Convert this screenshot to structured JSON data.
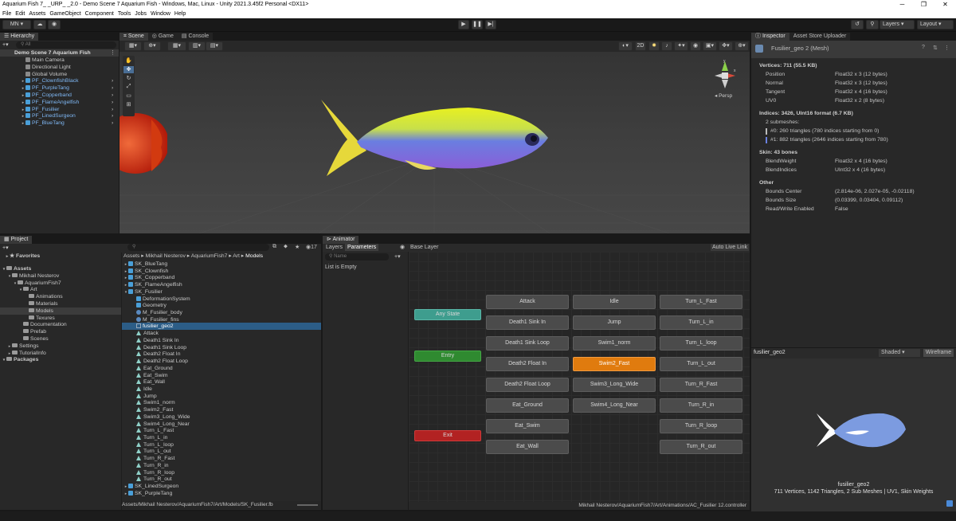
{
  "window": {
    "title": "Aquarium Fish 7_ _URP_ _2.0 - Demo Scene 7 Aquarium Fish - Windows, Mac, Linux - Unity 2021.3.45f2 Personal <DX11>",
    "minimize": "─",
    "maximize": "❐",
    "close": "✕"
  },
  "menu": [
    "File",
    "Edit",
    "Assets",
    "GameObject",
    "Component",
    "Tools",
    "Jobs",
    "Window",
    "Help"
  ],
  "toolbar": {
    "account": "MN ▾",
    "layers": "Layers",
    "layout": "Layout"
  },
  "hierarchy": {
    "tab": "Hierarchy",
    "search_placeholder": "All",
    "scene": "Demo Scene 7 Aquarium Fish",
    "items": [
      {
        "label": "Main Camera",
        "prefab": false
      },
      {
        "label": "Directional Light",
        "prefab": false
      },
      {
        "label": "Global Volume",
        "prefab": false
      },
      {
        "label": "PF_ClownfishBlack",
        "prefab": true
      },
      {
        "label": "PF_PurpleTang",
        "prefab": true
      },
      {
        "label": "PF_Copperband",
        "prefab": true
      },
      {
        "label": "PF_FlameAngelfish",
        "prefab": true
      },
      {
        "label": "PF_Fusilier",
        "prefab": true
      },
      {
        "label": "PF_LinedSurgeon",
        "prefab": true
      },
      {
        "label": "PF_BlueTang",
        "prefab": true
      }
    ]
  },
  "scene_view": {
    "tabs": [
      "Scene",
      "Game",
      "Console"
    ],
    "mode_2d": "2D",
    "persp": "Persp",
    "axis_y": "y",
    "axis_x": "x"
  },
  "inspector": {
    "tabs": [
      "Inspector",
      "Asset Store Uploader"
    ],
    "header": "Fusilier_geo 2 (Mesh)",
    "vertices_title": "Vertices: 711 (55.5 KB)",
    "vertex_rows": [
      {
        "k": "Position",
        "v": "Float32 x 3 (12 bytes)"
      },
      {
        "k": "Normal",
        "v": "Float32 x 3 (12 bytes)"
      },
      {
        "k": "Tangent",
        "v": "Float32 x 4 (16 bytes)"
      },
      {
        "k": "UV0",
        "v": "Float32 x 2 (8 bytes)"
      }
    ],
    "indices_title": "Indices: 3426, UInt16 format (6.7 KB)",
    "submeshes": "2 submeshes:",
    "submesh0": "#0: 260 triangles (780 indices starting from 0)",
    "submesh1": "#1: 882 triangles (2646 indices starting from 780)",
    "skin_title": "Skin: 43 bones",
    "skin_rows": [
      {
        "k": "BlendWeight",
        "v": "Float32 x 4 (16 bytes)"
      },
      {
        "k": "BlendIndices",
        "v": "UInt32 x 4 (16 bytes)"
      }
    ],
    "other_title": "Other",
    "other_rows": [
      {
        "k": "Bounds Center",
        "v": "(2.814e-06, 2.027e-05, -0.02118)"
      },
      {
        "k": "Bounds Size",
        "v": "(0.03399, 0.03404, 0.09112)"
      },
      {
        "k": "Read/Write Enabled",
        "v": "False"
      }
    ],
    "preview_name": "fusilier_geo2",
    "preview_shading": "Shaded",
    "preview_wireframe": "Wireframe",
    "preview_caption1": "fusilier_geo2",
    "preview_caption2": "711 Vertices, 1142 Triangles, 2 Sub Meshes | UV1, Skin Weights"
  },
  "project": {
    "tab": "Project",
    "favorites": "Favorites",
    "tree": [
      {
        "label": "Assets",
        "depth": 0,
        "bold": true
      },
      {
        "label": "Mikhail Nesterov",
        "depth": 1
      },
      {
        "label": "AquariumFish7",
        "depth": 2
      },
      {
        "label": "Art",
        "depth": 3
      },
      {
        "label": "Animations",
        "depth": 4
      },
      {
        "label": "Materials",
        "depth": 4
      },
      {
        "label": "Models",
        "depth": 4,
        "selected": true
      },
      {
        "label": "Texures",
        "depth": 4
      },
      {
        "label": "Documentation",
        "depth": 3
      },
      {
        "label": "Prefab",
        "depth": 3
      },
      {
        "label": "Scenes",
        "depth": 3
      },
      {
        "label": "Settings",
        "depth": 1
      },
      {
        "label": "TutorialInfo",
        "depth": 1
      },
      {
        "label": "Packages",
        "depth": 0,
        "bold": true
      }
    ],
    "count": "17",
    "breadcrumb": [
      "Assets",
      "Mikhail Nesterov",
      "AquariumFish7",
      "Art",
      "Models"
    ],
    "files": [
      {
        "label": "SK_BlueTang",
        "kind": "model",
        "depth": 0
      },
      {
        "label": "SK_Clownfish",
        "kind": "model",
        "depth": 0
      },
      {
        "label": "SK_Copperband",
        "kind": "model",
        "depth": 0
      },
      {
        "label": "SK_FlameAngelfish",
        "kind": "model",
        "depth": 0
      },
      {
        "label": "SK_Fusilier",
        "kind": "model",
        "depth": 0,
        "open": true
      },
      {
        "label": "DeformationSystem",
        "kind": "obj",
        "depth": 1
      },
      {
        "label": "Geometry",
        "kind": "obj",
        "depth": 1
      },
      {
        "label": "M_Fusilier_body",
        "kind": "mat",
        "depth": 1
      },
      {
        "label": "M_Fusilier_fins",
        "kind": "mat",
        "depth": 1
      },
      {
        "label": "fusilier_geo2",
        "kind": "mesh",
        "depth": 1,
        "selected": true
      },
      {
        "label": "Attack",
        "kind": "anim",
        "depth": 1
      },
      {
        "label": "Death1 Sink In",
        "kind": "anim",
        "depth": 1
      },
      {
        "label": "Death1 Sink Loop",
        "kind": "anim",
        "depth": 1
      },
      {
        "label": "Death2 Float In",
        "kind": "anim",
        "depth": 1
      },
      {
        "label": "Death2 Float Loop",
        "kind": "anim",
        "depth": 1
      },
      {
        "label": "Eat_Ground",
        "kind": "anim",
        "depth": 1
      },
      {
        "label": "Eat_Swim",
        "kind": "anim",
        "depth": 1
      },
      {
        "label": "Eat_Wall",
        "kind": "anim",
        "depth": 1
      },
      {
        "label": "Idle",
        "kind": "anim",
        "depth": 1
      },
      {
        "label": "Jump",
        "kind": "anim",
        "depth": 1
      },
      {
        "label": "Swim1_norm",
        "kind": "anim",
        "depth": 1
      },
      {
        "label": "Swim2_Fast",
        "kind": "anim",
        "depth": 1
      },
      {
        "label": "Swim3_Long_Wide",
        "kind": "anim",
        "depth": 1
      },
      {
        "label": "Swim4_Long_Near",
        "kind": "anim",
        "depth": 1
      },
      {
        "label": "Turn_L_Fast",
        "kind": "anim",
        "depth": 1
      },
      {
        "label": "Turn_L_in",
        "kind": "anim",
        "depth": 1
      },
      {
        "label": "Turn_L_loop",
        "kind": "anim",
        "depth": 1
      },
      {
        "label": "Turn_L_out",
        "kind": "anim",
        "depth": 1
      },
      {
        "label": "Turn_R_Fast",
        "kind": "anim",
        "depth": 1
      },
      {
        "label": "Turn_R_in",
        "kind": "anim",
        "depth": 1
      },
      {
        "label": "Turn_R_loop",
        "kind": "anim",
        "depth": 1
      },
      {
        "label": "Turn_R_out",
        "kind": "anim",
        "depth": 1
      },
      {
        "label": "SK_LinedSurgeon",
        "kind": "model",
        "depth": 0
      },
      {
        "label": "SK_PurpleTang",
        "kind": "model",
        "depth": 0
      }
    ],
    "footer_path": "Assets/Mikhail Nesterov/AquariumFish7/Art/Models/SK_Fusilier.fb"
  },
  "animator": {
    "tab": "Animator",
    "subtabs": [
      "Layers",
      "Parameters"
    ],
    "layer": "Base Layer",
    "auto_live": "Auto Live Link",
    "search_placeholder": "Name",
    "list_empty": "List is Empty",
    "any_state": "Any State",
    "entry": "Entry",
    "exit": "Exit",
    "col1": [
      "Attack",
      "Death1 Sink In",
      "Death1 Sink Loop",
      "Death2 Float In",
      "Death2 Float Loop",
      "Eat_Ground",
      "Eat_Swim",
      "Eat_Wall"
    ],
    "col2": [
      "Idle",
      "Jump",
      "Swim1_norm",
      "Swim2_Fast",
      "Swim3_Long_Wide",
      "Swim4_Long_Near"
    ],
    "col3": [
      "Turn_L_Fast",
      "Turn_L_in",
      "Turn_L_loop",
      "Turn_L_out",
      "Turn_R_Fast",
      "Turn_R_in",
      "Turn_R_loop",
      "Turn_R_out"
    ],
    "default_state": "Swim2_Fast",
    "footer_path": "Mikhail Nesterov/AquariumFish7/Art/Animations/AC_Fusilier 12.controller"
  },
  "colors": {
    "accent": "#e07b0e",
    "entry": "#2f8a30",
    "exit": "#b22222",
    "any": "#3e9d8e",
    "selection": "#2c5d87"
  }
}
